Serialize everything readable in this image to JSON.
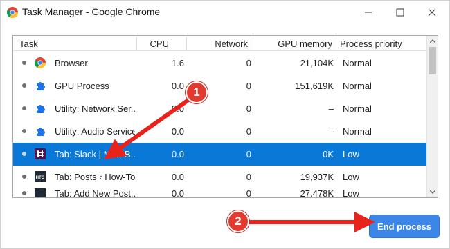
{
  "window": {
    "title": "Task Manager - Google Chrome"
  },
  "table": {
    "headers": {
      "task": "Task",
      "cpu": "CPU",
      "network": "Network",
      "gpu_memory": "GPU memory",
      "priority": "Process priority"
    },
    "rows": [
      {
        "icon": "chrome-icon",
        "task": "Browser",
        "cpu": "1.6",
        "network": "0",
        "gpu_memory": "21,104K",
        "priority": "Normal"
      },
      {
        "icon": "puzzle-icon",
        "task": "GPU Process",
        "cpu": "0.0",
        "network": "0",
        "gpu_memory": "151,619K",
        "priority": "Normal"
      },
      {
        "icon": "puzzle-icon",
        "task": "Utility: Network Ser...",
        "cpu": "0.0",
        "network": "0",
        "gpu_memory": "–",
        "priority": "Normal"
      },
      {
        "icon": "puzzle-icon",
        "task": "Utility: Audio Service",
        "cpu": "0.0",
        "network": "0",
        "gpu_memory": "–",
        "priority": "Normal"
      },
      {
        "icon": "slack-icon",
        "task": "Tab: Slack | * e... B...",
        "cpu": "0.0",
        "network": "0",
        "gpu_memory": "0K",
        "priority": "Low",
        "selected": true
      },
      {
        "icon": "htg-icon",
        "task": "Tab: Posts ‹ How-To...",
        "cpu": "0.0",
        "network": "0",
        "gpu_memory": "19,937K",
        "priority": "Low"
      },
      {
        "icon": "htg-icon",
        "task": "Tab: Add New Post...",
        "cpu": "0.0",
        "network": "0",
        "gpu_memory": "27,478K",
        "priority": "Low"
      }
    ],
    "htg_icon_text": "HTG"
  },
  "buttons": {
    "end_process": "End process"
  },
  "annotations": {
    "badge1": "1",
    "badge2": "2",
    "arrow_color": "#e8231b"
  },
  "colors": {
    "selection": "#0a78d7",
    "button": "#3b86e6"
  }
}
